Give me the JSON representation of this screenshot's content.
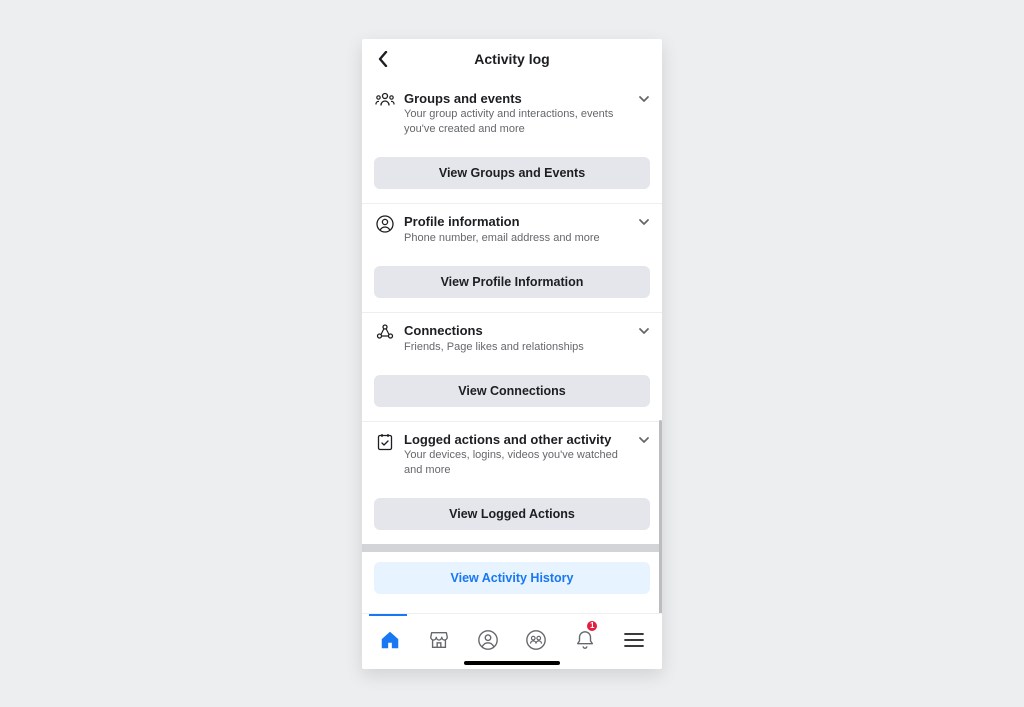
{
  "header": {
    "title": "Activity log"
  },
  "sections": [
    {
      "icon": "group-icon",
      "title": "Groups and events",
      "subtitle": "Your group activity and interactions, events you've created and more",
      "button": "View Groups and Events"
    },
    {
      "icon": "profile-icon",
      "title": "Profile information",
      "subtitle": "Phone number, email address and more",
      "button": "View Profile Information"
    },
    {
      "icon": "connections-icon",
      "title": "Connections",
      "subtitle": "Friends, Page likes and relationships",
      "button": "View Connections"
    },
    {
      "icon": "logged-actions-icon",
      "title": "Logged actions and other activity",
      "subtitle": "Your devices, logins, videos you've watched and more",
      "button": "View Logged Actions"
    }
  ],
  "footer_action": {
    "label": "View Activity History"
  },
  "bottom_nav": {
    "notification_badge": "1"
  },
  "colors": {
    "accent": "#1877f2",
    "badge": "#e41e3f"
  }
}
